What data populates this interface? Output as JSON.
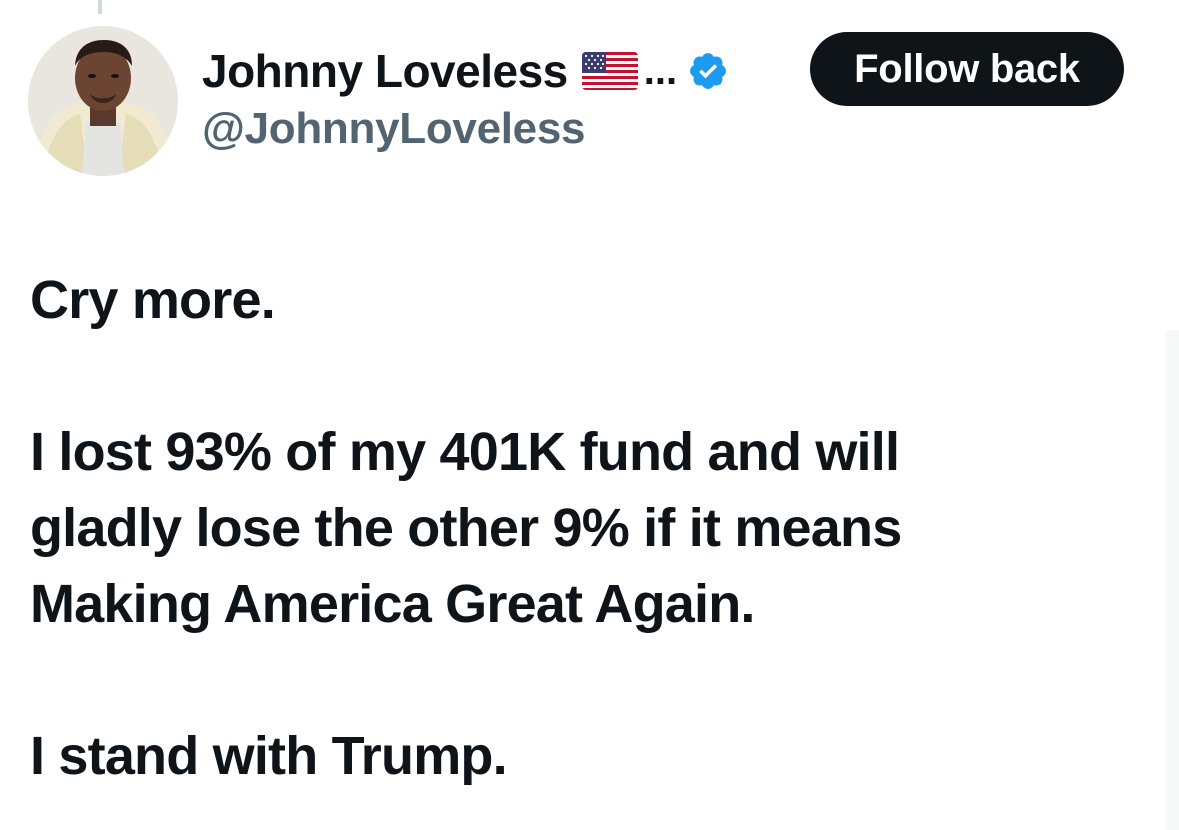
{
  "tweet": {
    "author": {
      "display_name": "Johnny Loveless",
      "flag_emoji": "us-flag-icon",
      "truncation": "...",
      "verified_icon": "verified-badge-icon",
      "handle": "@JohnnyLoveless",
      "avatar": "avatar"
    },
    "follow_button_label": "Follow back",
    "text": {
      "line1": "Cry more.",
      "para2_line1": "I lost 93% of my 401K fund and will",
      "para2_line2": "gladly lose the other 9% if it means",
      "para2_line3": "Making America Great Again.",
      "line3": "I stand with Trump."
    }
  },
  "colors": {
    "text_primary": "#0f1419",
    "text_secondary": "#536471",
    "verified_blue": "#1d9bf0",
    "button_bg": "#0f1419",
    "button_text": "#ffffff"
  }
}
